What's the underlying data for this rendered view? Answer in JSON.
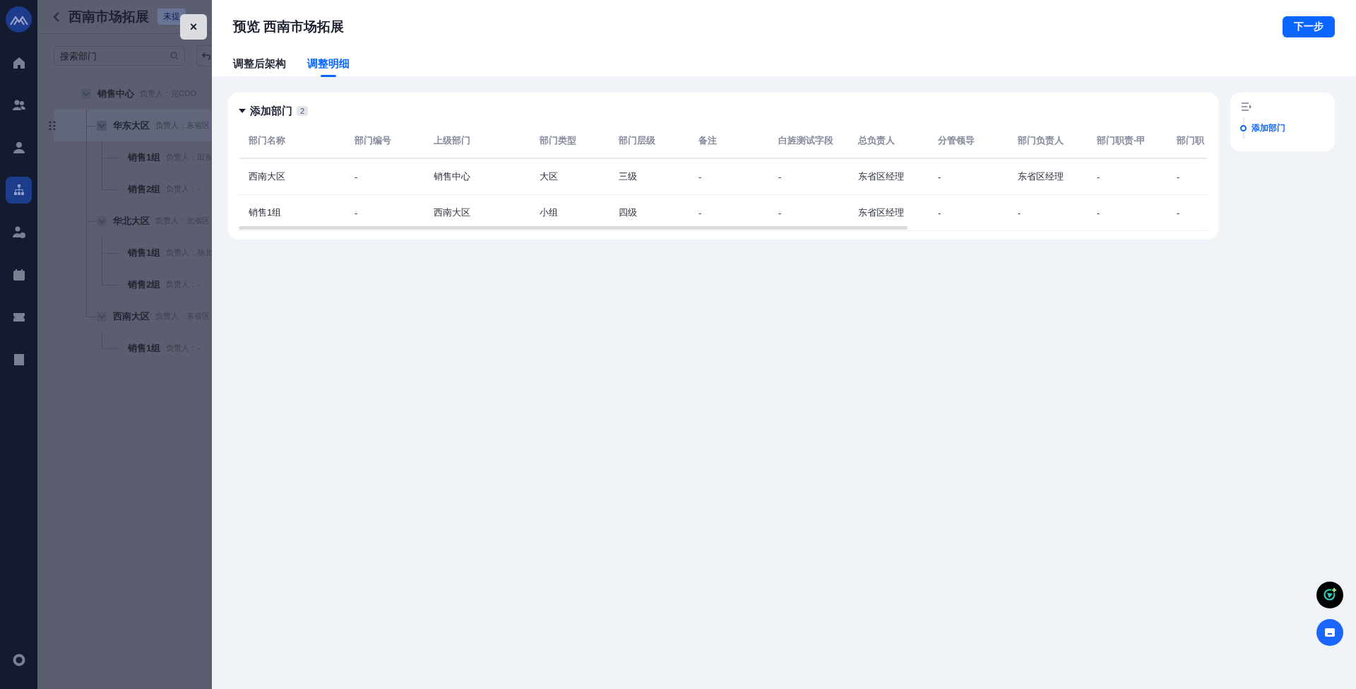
{
  "app_sidebar": {
    "items": [
      {
        "selected": false
      },
      {
        "selected": false
      },
      {
        "selected": false
      },
      {
        "selected": true
      },
      {
        "selected": false
      },
      {
        "selected": false
      },
      {
        "selected": false
      },
      {
        "selected": false
      }
    ]
  },
  "page": {
    "title": "西南市场拓展",
    "status_badge": "未提",
    "search": {
      "placeholder": "搜索部门"
    },
    "tree": [
      {
        "name": "销售中心",
        "owner": "负责人：完COO",
        "expanded": true,
        "selected": false,
        "children": [
          {
            "name": "华东大区",
            "owner": "负责人：东省区",
            "expanded": true,
            "selected": true,
            "children": [
              {
                "name": "销售1组",
                "owner": "负责人：田东",
                "selected": false
              },
              {
                "name": "销售2组",
                "owner": "负责人：-",
                "selected": false
              }
            ]
          },
          {
            "name": "华北大区",
            "owner": "负责人：北省区",
            "expanded": true,
            "selected": false,
            "children": [
              {
                "name": "销售1组",
                "owner": "负责人：杨北",
                "selected": false
              },
              {
                "name": "销售2组",
                "owner": "负责人：-",
                "selected": false
              }
            ]
          },
          {
            "name": "西南大区",
            "owner": "负责人：东省区",
            "expanded": true,
            "selected": false,
            "children": [
              {
                "name": "销售1组",
                "owner": "负责人：-",
                "selected": false
              }
            ]
          }
        ]
      }
    ]
  },
  "drawer": {
    "close_label": "×",
    "title": "预览 西南市场拓展",
    "next_button": "下一步",
    "tabs": [
      {
        "label": "调整后架构",
        "selected": false
      },
      {
        "label": "调整明细",
        "selected": true
      }
    ],
    "section": {
      "title": "添加部门",
      "count": "2",
      "expanded": true,
      "columns": [
        "部门名称",
        "部门编号",
        "上级部门",
        "部门类型",
        "部门层级",
        "备注",
        "白旌测试字段",
        "总负责人",
        "分管领导",
        "部门负责人",
        "部门职责-甲",
        "部门职"
      ],
      "rows": [
        [
          "西南大区",
          "-",
          "销售中心",
          "大区",
          "三级",
          "-",
          "-",
          "东省区经理",
          "-",
          "东省区经理",
          "-",
          "-"
        ],
        [
          "销售1组",
          "-",
          "西南大区",
          "小组",
          "四级",
          "-",
          "-",
          "东省区经理",
          "-",
          "-",
          "-",
          "-"
        ]
      ]
    },
    "anchor": {
      "items": [
        {
          "label": "添加部门",
          "selected": true
        }
      ]
    }
  }
}
